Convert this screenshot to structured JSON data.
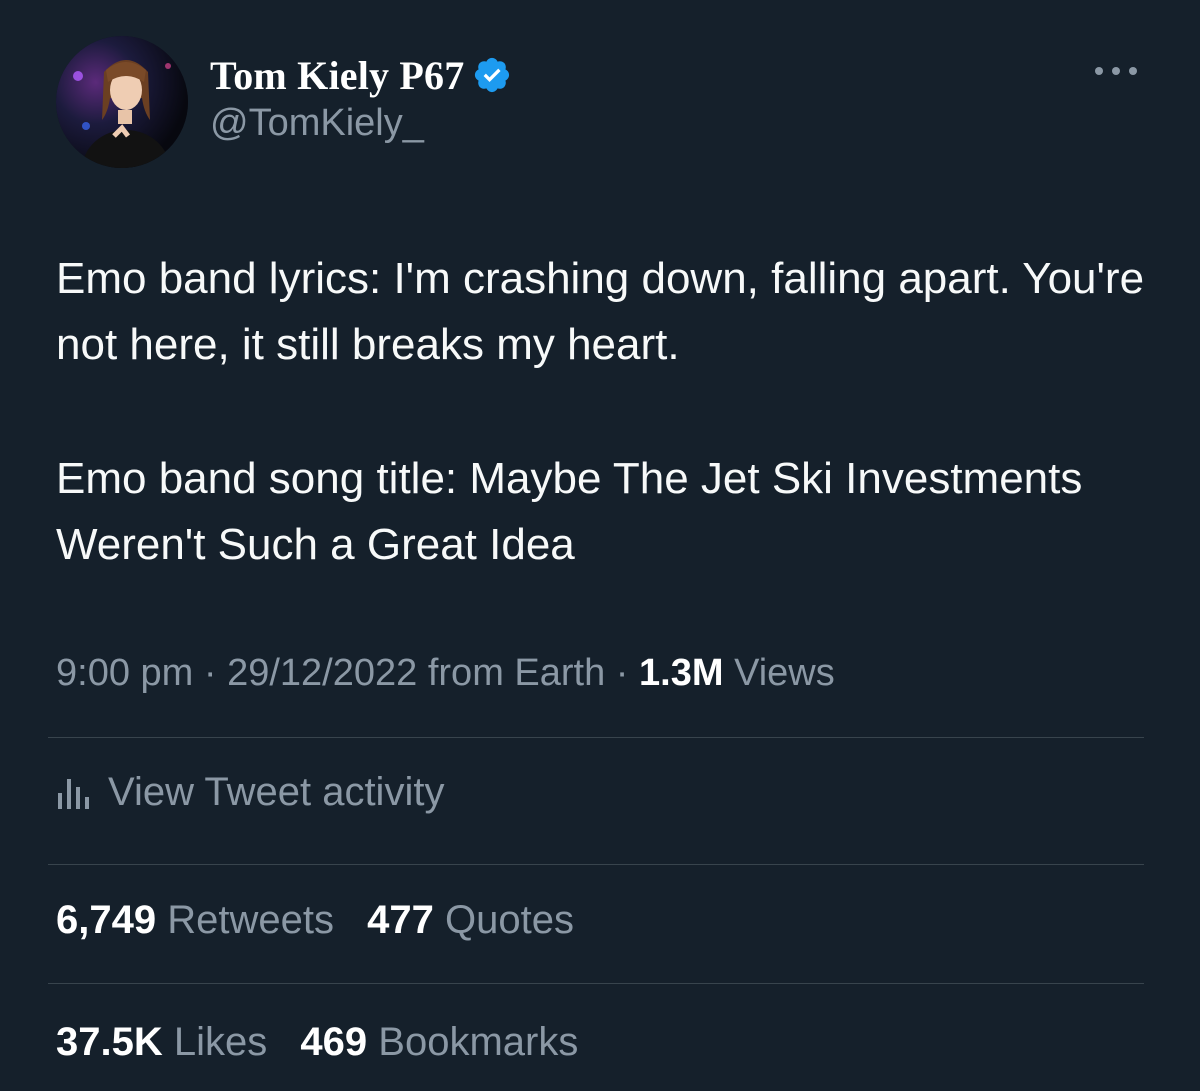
{
  "author": {
    "display_name": "Tom Kiely P67",
    "handle": "@TomKiely_",
    "verified": true
  },
  "tweet": {
    "paragraphs": [
      "Emo band lyrics: I'm crashing down, falling apart. You're not here, it still breaks my heart.",
      "Emo band song title: Maybe The Jet Ski Investments Weren't Such a Great Idea"
    ],
    "time": "9:00 pm",
    "separator": "·",
    "date": "29/12/2022",
    "source": "from Earth",
    "views_count": "1.3M",
    "views_label": "Views"
  },
  "activity": {
    "label": "View Tweet activity"
  },
  "stats": {
    "retweets_count": "6,749",
    "retweets_label": "Retweets",
    "quotes_count": "477",
    "quotes_label": "Quotes",
    "likes_count": "37.5K",
    "likes_label": "Likes",
    "bookmarks_count": "469",
    "bookmarks_label": "Bookmarks"
  },
  "icons": {
    "verified": "verified-badge-icon",
    "more": "more-options-icon",
    "activity": "bar-chart-icon"
  },
  "colors": {
    "background": "#15202b",
    "primary_text": "#f7f9f9",
    "secondary_text": "#8b98a5",
    "divider": "#38444d",
    "verified_blue": "#1d9bf0"
  }
}
